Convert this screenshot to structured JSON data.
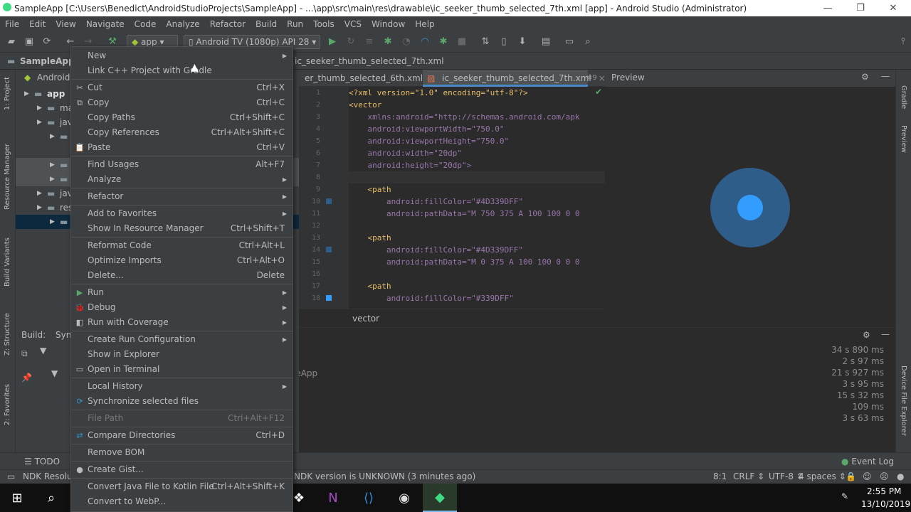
{
  "window": {
    "title": "SampleApp [C:\\Users\\Benedict\\AndroidStudioProjects\\SampleApp] - ...\\app\\src\\main\\res\\drawable\\ic_seeker_thumb_selected_7th.xml [app] - Android Studio (Administrator)",
    "minimize": "—",
    "maximize": "❐",
    "close": "✕"
  },
  "menubar": [
    "File",
    "Edit",
    "View",
    "Navigate",
    "Code",
    "Analyze",
    "Refactor",
    "Build",
    "Run",
    "Tools",
    "VCS",
    "Window",
    "Help"
  ],
  "toolbar": {
    "run_config": "app",
    "device": "Android TV (1080p) API 28"
  },
  "navbar": {
    "project": "SampleApp",
    "file": "ic_seeker_thumb_selected_7th.xml"
  },
  "left_strip": [
    "1: Project",
    "Resource Manager",
    "Build Variants",
    "Z: Structure",
    "2: Favorites"
  ],
  "right_strip": [
    "Gradle",
    "Preview",
    "Device File Explorer"
  ],
  "project_panel": {
    "view_mode": "Android",
    "rows": [
      {
        "label": "app",
        "indent": 1
      },
      {
        "label": "ma",
        "indent": 2
      },
      {
        "label": "java",
        "indent": 2
      },
      {
        "label": "",
        "indent": 3
      },
      {
        "label": "",
        "indent": 3
      },
      {
        "label": "",
        "indent": 3
      },
      {
        "label": "java",
        "indent": 2
      },
      {
        "label": "res",
        "indent": 2
      },
      {
        "label": "",
        "indent": 3
      }
    ]
  },
  "editor": {
    "tabs": [
      {
        "label": "er_thumb_selected_6th.xml",
        "active": false
      },
      {
        "label": "ic_seeker_thumb_selected_7th.xml",
        "active": true
      }
    ],
    "tab_count": "9",
    "lines": [
      {
        "n": "1",
        "text": "<?xml version=\"1.0\" encoding=\"utf-8\"?>"
      },
      {
        "n": "2",
        "text": "<vector"
      },
      {
        "n": "3",
        "text": "    xmlns:android=\"http://schemas.android.com/apk"
      },
      {
        "n": "4",
        "text": "    android:viewportWidth=\"750.0\""
      },
      {
        "n": "5",
        "text": "    android:viewportHeight=\"750.0\""
      },
      {
        "n": "6",
        "text": "    android:width=\"20dp\""
      },
      {
        "n": "7",
        "text": "    android:height=\"20dp\">"
      },
      {
        "n": "8",
        "text": ""
      },
      {
        "n": "9",
        "text": "    <path"
      },
      {
        "n": "10",
        "text": "        android:fillColor=\"#4D339DFF\""
      },
      {
        "n": "11",
        "text": "        android:pathData=\"M 750 375 A 100 100 0 0"
      },
      {
        "n": "12",
        "text": ""
      },
      {
        "n": "13",
        "text": "    <path"
      },
      {
        "n": "14",
        "text": "        android:fillColor=\"#4D339DFF\""
      },
      {
        "n": "15",
        "text": "        android:pathData=\"M 0 375 A 100 100 0 0 0"
      },
      {
        "n": "16",
        "text": ""
      },
      {
        "n": "17",
        "text": "    <path"
      },
      {
        "n": "18",
        "text": "        android:fillColor=\"#339DFF\""
      }
    ],
    "breadcrumb": "vector"
  },
  "preview": {
    "title": "Preview",
    "outer_color": "#2f5d8a",
    "inner_color": "#339dff"
  },
  "build_panel": {
    "label": "Build:",
    "tab": "Syn",
    "status_text": "leApp",
    "timings": [
      "34 s 890 ms",
      "2 s 97 ms",
      "21 s 927 ms",
      "3 s 95 ms",
      "15 s 32 ms",
      "109 ms",
      "3 s 63 ms"
    ]
  },
  "tool_windows": {
    "todo": "TODO",
    "event_log": "Event Log"
  },
  "status_bar": {
    "left": "NDK Resolut",
    "message": "NDK version is UNKNOWN (3 minutes ago)",
    "position": "8:1",
    "line_sep": "CRLF",
    "encoding": "UTF-8",
    "indent": "4 spaces"
  },
  "taskbar": {
    "time": "2:55 PM",
    "date": "13/10/2019"
  },
  "context_menu": {
    "items": [
      {
        "label": "New",
        "shortcut": "",
        "submenu": true,
        "icon": ""
      },
      {
        "label": "Link C++ Project with Gradle",
        "shortcut": "",
        "submenu": false,
        "icon": ""
      },
      {
        "sep": true
      },
      {
        "label": "Cut",
        "shortcut": "Ctrl+X",
        "submenu": false,
        "icon": "✂"
      },
      {
        "label": "Copy",
        "shortcut": "Ctrl+C",
        "submenu": false,
        "icon": "⧉"
      },
      {
        "label": "Copy Paths",
        "shortcut": "Ctrl+Shift+C",
        "submenu": false,
        "icon": ""
      },
      {
        "label": "Copy References",
        "shortcut": "Ctrl+Alt+Shift+C",
        "submenu": false,
        "icon": ""
      },
      {
        "label": "Paste",
        "shortcut": "Ctrl+V",
        "submenu": false,
        "icon": "📋"
      },
      {
        "sep": true
      },
      {
        "label": "Find Usages",
        "shortcut": "Alt+F7",
        "submenu": false,
        "icon": ""
      },
      {
        "label": "Analyze",
        "shortcut": "",
        "submenu": true,
        "icon": ""
      },
      {
        "sep": true
      },
      {
        "label": "Refactor",
        "shortcut": "",
        "submenu": true,
        "icon": ""
      },
      {
        "sep": true
      },
      {
        "label": "Add to Favorites",
        "shortcut": "",
        "submenu": true,
        "icon": ""
      },
      {
        "label": "Show In Resource Manager",
        "shortcut": "Ctrl+Shift+T",
        "submenu": false,
        "icon": ""
      },
      {
        "sep": true
      },
      {
        "label": "Reformat Code",
        "shortcut": "Ctrl+Alt+L",
        "submenu": false,
        "icon": ""
      },
      {
        "label": "Optimize Imports",
        "shortcut": "Ctrl+Alt+O",
        "submenu": false,
        "icon": ""
      },
      {
        "label": "Delete...",
        "shortcut": "Delete",
        "submenu": false,
        "icon": ""
      },
      {
        "sep": true
      },
      {
        "label": "Run",
        "shortcut": "",
        "submenu": true,
        "icon": "▶"
      },
      {
        "label": "Debug",
        "shortcut": "",
        "submenu": true,
        "icon": "🐞"
      },
      {
        "label": "Run with Coverage",
        "shortcut": "",
        "submenu": true,
        "icon": "◧"
      },
      {
        "sep": true
      },
      {
        "label": "Create Run Configuration",
        "shortcut": "",
        "submenu": true,
        "icon": ""
      },
      {
        "label": "Show in Explorer",
        "shortcut": "",
        "submenu": false,
        "icon": ""
      },
      {
        "label": "Open in Terminal",
        "shortcut": "",
        "submenu": false,
        "icon": "▭"
      },
      {
        "sep": true
      },
      {
        "label": "Local History",
        "shortcut": "",
        "submenu": true,
        "icon": ""
      },
      {
        "label": "Synchronize selected files",
        "shortcut": "",
        "submenu": false,
        "icon": "⟳"
      },
      {
        "sep": true
      },
      {
        "label": "File Path",
        "shortcut": "Ctrl+Alt+F12",
        "submenu": false,
        "icon": "",
        "disabled": true
      },
      {
        "sep": true
      },
      {
        "label": "Compare Directories",
        "shortcut": "Ctrl+D",
        "submenu": false,
        "icon": "⇄"
      },
      {
        "sep": true
      },
      {
        "label": "Remove BOM",
        "shortcut": "",
        "submenu": false,
        "icon": ""
      },
      {
        "sep": true
      },
      {
        "label": "Create Gist...",
        "shortcut": "",
        "submenu": false,
        "icon": "●"
      },
      {
        "sep": true
      },
      {
        "label": "Convert Java File to Kotlin File",
        "shortcut": "Ctrl+Alt+Shift+K",
        "submenu": false,
        "icon": ""
      },
      {
        "label": "Convert to WebP...",
        "shortcut": "",
        "submenu": false,
        "icon": ""
      }
    ]
  }
}
